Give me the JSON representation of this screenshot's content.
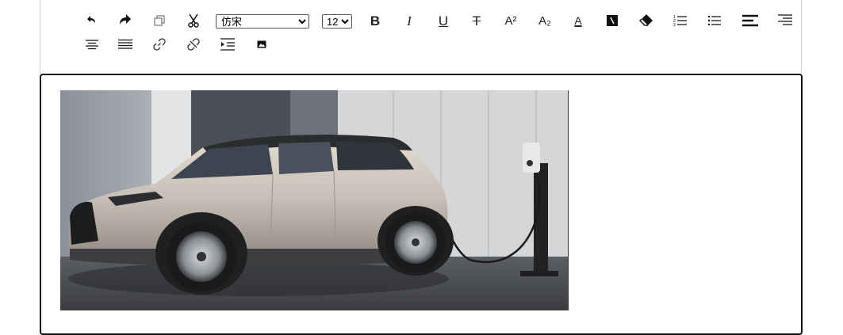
{
  "toolbar": {
    "font_family": {
      "selected": "仿宋",
      "options": [
        "仿宋"
      ]
    },
    "font_size": {
      "selected": "12",
      "options": [
        "12"
      ]
    },
    "bold_label": "B",
    "italic_label": "I",
    "underline_label": "U",
    "strike_label": "T",
    "superscript_label": "A²",
    "subscript_label": "A₂",
    "font_color_label": "A",
    "buttons_row1": [
      "undo-icon",
      "redo-icon",
      "copy-icon",
      "cut-icon",
      "font-family-select",
      "font-size-select",
      "bold-icon",
      "italic-icon",
      "underline-icon",
      "strikethrough-icon",
      "superscript-icon",
      "subscript-icon",
      "font-color-icon",
      "highlight-icon",
      "eraser-icon",
      "ordered-list-icon",
      "unordered-list-icon",
      "align-left-icon",
      "align-right-icon"
    ],
    "buttons_row2": [
      "align-center-icon",
      "justify-icon",
      "link-icon",
      "unlink-icon",
      "indent-icon",
      "image-icon"
    ]
  },
  "editor": {
    "image": "car-photo"
  }
}
